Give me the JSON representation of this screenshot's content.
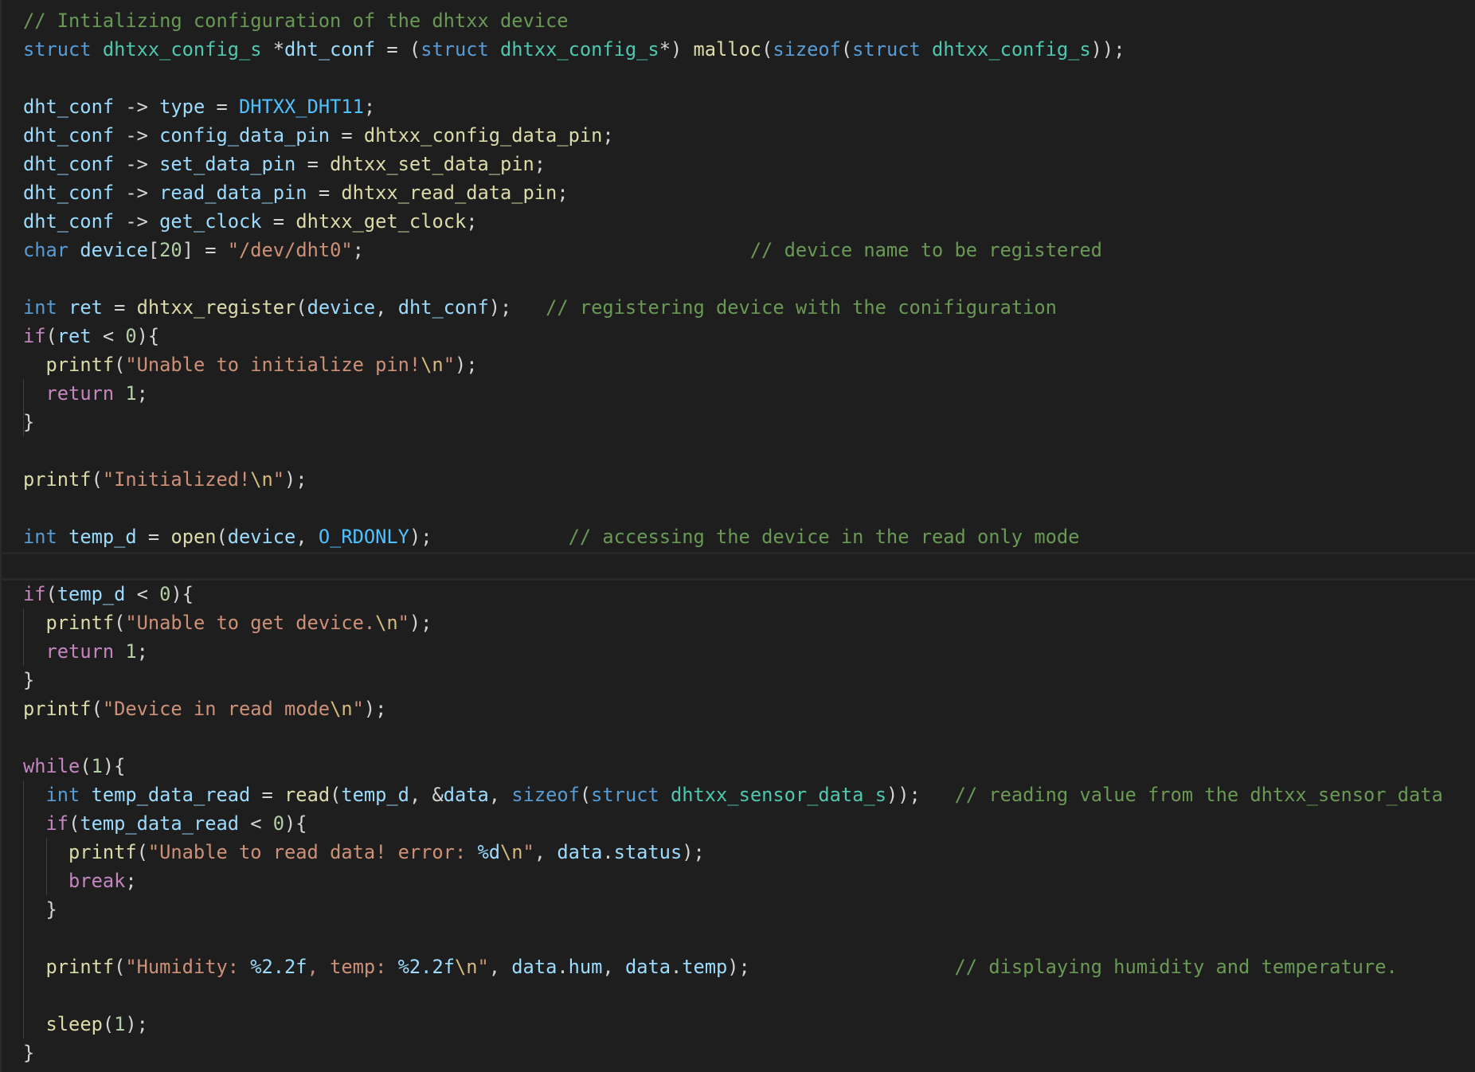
{
  "editor": {
    "colors": {
      "background": "#1e1e1e",
      "comment": "#6a9955",
      "keyword": "#569cd6",
      "control": "#c586c0",
      "type": "#4ec9b0",
      "variable": "#9cdcfe",
      "function": "#dcdcaa",
      "string": "#ce9178",
      "number": "#b5cea8",
      "constant": "#4fc1ff"
    },
    "lines": [
      [
        [
          "comment",
          "// Intializing configuration of the dhtxx device"
        ]
      ],
      [
        [
          "keyword",
          "struct"
        ],
        [
          "text",
          " "
        ],
        [
          "type",
          "dhtxx_config_s"
        ],
        [
          "text",
          " "
        ],
        [
          "operator",
          "*"
        ],
        [
          "variable",
          "dht_conf"
        ],
        [
          "text",
          " "
        ],
        [
          "operator",
          "="
        ],
        [
          "text",
          " "
        ],
        [
          "punct",
          "("
        ],
        [
          "keyword",
          "struct"
        ],
        [
          "text",
          " "
        ],
        [
          "type",
          "dhtxx_config_s"
        ],
        [
          "operator",
          "*"
        ],
        [
          "punct",
          ")"
        ],
        [
          "text",
          " "
        ],
        [
          "function",
          "malloc"
        ],
        [
          "punct",
          "("
        ],
        [
          "keyword",
          "sizeof"
        ],
        [
          "punct",
          "("
        ],
        [
          "keyword",
          "struct"
        ],
        [
          "text",
          " "
        ],
        [
          "type",
          "dhtxx_config_s"
        ],
        [
          "punct",
          "));"
        ]
      ],
      [],
      [
        [
          "variable",
          "dht_conf"
        ],
        [
          "text",
          " "
        ],
        [
          "operator",
          "->"
        ],
        [
          "text",
          " "
        ],
        [
          "variable",
          "type"
        ],
        [
          "text",
          " "
        ],
        [
          "operator",
          "="
        ],
        [
          "text",
          " "
        ],
        [
          "constant",
          "DHTXX_DHT11"
        ],
        [
          "punct",
          ";"
        ]
      ],
      [
        [
          "variable",
          "dht_conf"
        ],
        [
          "text",
          " "
        ],
        [
          "operator",
          "->"
        ],
        [
          "text",
          " "
        ],
        [
          "variable",
          "config_data_pin"
        ],
        [
          "text",
          " "
        ],
        [
          "operator",
          "="
        ],
        [
          "text",
          " "
        ],
        [
          "function",
          "dhtxx_config_data_pin"
        ],
        [
          "punct",
          ";"
        ]
      ],
      [
        [
          "variable",
          "dht_conf"
        ],
        [
          "text",
          " "
        ],
        [
          "operator",
          "->"
        ],
        [
          "text",
          " "
        ],
        [
          "variable",
          "set_data_pin"
        ],
        [
          "text",
          " "
        ],
        [
          "operator",
          "="
        ],
        [
          "text",
          " "
        ],
        [
          "function",
          "dhtxx_set_data_pin"
        ],
        [
          "punct",
          ";"
        ]
      ],
      [
        [
          "variable",
          "dht_conf"
        ],
        [
          "text",
          " "
        ],
        [
          "operator",
          "->"
        ],
        [
          "text",
          " "
        ],
        [
          "variable",
          "read_data_pin"
        ],
        [
          "text",
          " "
        ],
        [
          "operator",
          "="
        ],
        [
          "text",
          " "
        ],
        [
          "function",
          "dhtxx_read_data_pin"
        ],
        [
          "punct",
          ";"
        ]
      ],
      [
        [
          "variable",
          "dht_conf"
        ],
        [
          "text",
          " "
        ],
        [
          "operator",
          "->"
        ],
        [
          "text",
          " "
        ],
        [
          "variable",
          "get_clock"
        ],
        [
          "text",
          " "
        ],
        [
          "operator",
          "="
        ],
        [
          "text",
          " "
        ],
        [
          "function",
          "dhtxx_get_clock"
        ],
        [
          "punct",
          ";"
        ]
      ],
      [
        [
          "keyword",
          "char"
        ],
        [
          "text",
          " "
        ],
        [
          "variable",
          "device"
        ],
        [
          "punct",
          "["
        ],
        [
          "number",
          "20"
        ],
        [
          "punct",
          "]"
        ],
        [
          "text",
          " "
        ],
        [
          "operator",
          "="
        ],
        [
          "text",
          " "
        ],
        [
          "string",
          "\"/dev/dht0\""
        ],
        [
          "punct",
          ";"
        ],
        [
          "text",
          "                                  "
        ],
        [
          "comment",
          "// device name to be registered"
        ]
      ],
      [],
      [
        [
          "keyword",
          "int"
        ],
        [
          "text",
          " "
        ],
        [
          "variable",
          "ret"
        ],
        [
          "text",
          " "
        ],
        [
          "operator",
          "="
        ],
        [
          "text",
          " "
        ],
        [
          "function",
          "dhtxx_register"
        ],
        [
          "punct",
          "("
        ],
        [
          "variable",
          "device"
        ],
        [
          "punct",
          ","
        ],
        [
          "text",
          " "
        ],
        [
          "variable",
          "dht_conf"
        ],
        [
          "punct",
          ");"
        ],
        [
          "text",
          "   "
        ],
        [
          "comment",
          "// registering device with the conifiguration"
        ]
      ],
      [
        [
          "control",
          "if"
        ],
        [
          "punct",
          "("
        ],
        [
          "variable",
          "ret"
        ],
        [
          "text",
          " "
        ],
        [
          "operator",
          "<"
        ],
        [
          "text",
          " "
        ],
        [
          "number",
          "0"
        ],
        [
          "punct",
          "){"
        ]
      ],
      [
        [
          "text",
          "  "
        ],
        [
          "function",
          "printf"
        ],
        [
          "punct",
          "("
        ],
        [
          "string",
          "\"Unable to initialize pin!"
        ],
        [
          "escape",
          "\\n"
        ],
        [
          "string",
          "\""
        ],
        [
          "punct",
          ");"
        ]
      ],
      [
        [
          "text",
          "  "
        ],
        [
          "control",
          "return"
        ],
        [
          "text",
          " "
        ],
        [
          "number",
          "1"
        ],
        [
          "punct",
          ";"
        ]
      ],
      [
        [
          "punct",
          "}"
        ]
      ],
      [],
      [
        [
          "function",
          "printf"
        ],
        [
          "punct",
          "("
        ],
        [
          "string",
          "\"Initialized!"
        ],
        [
          "escape",
          "\\n"
        ],
        [
          "string",
          "\""
        ],
        [
          "punct",
          ");"
        ]
      ],
      [],
      [
        [
          "keyword",
          "int"
        ],
        [
          "text",
          " "
        ],
        [
          "variable",
          "temp_d"
        ],
        [
          "text",
          " "
        ],
        [
          "operator",
          "="
        ],
        [
          "text",
          " "
        ],
        [
          "function",
          "open"
        ],
        [
          "punct",
          "("
        ],
        [
          "variable",
          "device"
        ],
        [
          "punct",
          ","
        ],
        [
          "text",
          " "
        ],
        [
          "constant",
          "O_RDONLY"
        ],
        [
          "punct",
          ");"
        ],
        [
          "text",
          "            "
        ],
        [
          "comment",
          "// accessing the device in the read only mode"
        ]
      ],
      [],
      [
        [
          "control",
          "if"
        ],
        [
          "punct",
          "("
        ],
        [
          "variable",
          "temp_d"
        ],
        [
          "text",
          " "
        ],
        [
          "operator",
          "<"
        ],
        [
          "text",
          " "
        ],
        [
          "number",
          "0"
        ],
        [
          "punct",
          "){"
        ]
      ],
      [
        [
          "text",
          "  "
        ],
        [
          "function",
          "printf"
        ],
        [
          "punct",
          "("
        ],
        [
          "string",
          "\"Unable to get device."
        ],
        [
          "escape",
          "\\n"
        ],
        [
          "string",
          "\""
        ],
        [
          "punct",
          ");"
        ]
      ],
      [
        [
          "text",
          "  "
        ],
        [
          "control",
          "return"
        ],
        [
          "text",
          " "
        ],
        [
          "number",
          "1"
        ],
        [
          "punct",
          ";"
        ]
      ],
      [
        [
          "punct",
          "}"
        ]
      ],
      [
        [
          "function",
          "printf"
        ],
        [
          "punct",
          "("
        ],
        [
          "string",
          "\"Device in read mode"
        ],
        [
          "escape",
          "\\n"
        ],
        [
          "string",
          "\""
        ],
        [
          "punct",
          ");"
        ]
      ],
      [],
      [
        [
          "control",
          "while"
        ],
        [
          "punct",
          "("
        ],
        [
          "number",
          "1"
        ],
        [
          "punct",
          "){"
        ]
      ],
      [
        [
          "text",
          "  "
        ],
        [
          "keyword",
          "int"
        ],
        [
          "text",
          " "
        ],
        [
          "variable",
          "temp_data_read"
        ],
        [
          "text",
          " "
        ],
        [
          "operator",
          "="
        ],
        [
          "text",
          " "
        ],
        [
          "function",
          "read"
        ],
        [
          "punct",
          "("
        ],
        [
          "variable",
          "temp_d"
        ],
        [
          "punct",
          ","
        ],
        [
          "text",
          " "
        ],
        [
          "operator",
          "&"
        ],
        [
          "variable",
          "data"
        ],
        [
          "punct",
          ","
        ],
        [
          "text",
          " "
        ],
        [
          "keyword",
          "sizeof"
        ],
        [
          "punct",
          "("
        ],
        [
          "keyword",
          "struct"
        ],
        [
          "text",
          " "
        ],
        [
          "type",
          "dhtxx_sensor_data_s"
        ],
        [
          "punct",
          "));"
        ],
        [
          "text",
          "   "
        ],
        [
          "comment",
          "// reading value from the dhtxx_sensor_data"
        ]
      ],
      [
        [
          "text",
          "  "
        ],
        [
          "control",
          "if"
        ],
        [
          "punct",
          "("
        ],
        [
          "variable",
          "temp_data_read"
        ],
        [
          "text",
          " "
        ],
        [
          "operator",
          "<"
        ],
        [
          "text",
          " "
        ],
        [
          "number",
          "0"
        ],
        [
          "punct",
          "){"
        ]
      ],
      [
        [
          "text",
          "    "
        ],
        [
          "function",
          "printf"
        ],
        [
          "punct",
          "("
        ],
        [
          "string",
          "\"Unable to read data! error: "
        ],
        [
          "format",
          "%d"
        ],
        [
          "escape",
          "\\n"
        ],
        [
          "string",
          "\""
        ],
        [
          "punct",
          ","
        ],
        [
          "text",
          " "
        ],
        [
          "variable",
          "data"
        ],
        [
          "punct",
          "."
        ],
        [
          "variable",
          "status"
        ],
        [
          "punct",
          ");"
        ]
      ],
      [
        [
          "text",
          "    "
        ],
        [
          "control",
          "break"
        ],
        [
          "punct",
          ";"
        ]
      ],
      [
        [
          "text",
          "  "
        ],
        [
          "punct",
          "}"
        ]
      ],
      [],
      [
        [
          "text",
          "  "
        ],
        [
          "function",
          "printf"
        ],
        [
          "punct",
          "("
        ],
        [
          "string",
          "\"Humidity: "
        ],
        [
          "format",
          "%2.2f"
        ],
        [
          "string",
          ", temp: "
        ],
        [
          "format",
          "%2.2f"
        ],
        [
          "escape",
          "\\n"
        ],
        [
          "string",
          "\""
        ],
        [
          "punct",
          ","
        ],
        [
          "text",
          " "
        ],
        [
          "variable",
          "data"
        ],
        [
          "punct",
          "."
        ],
        [
          "variable",
          "hum"
        ],
        [
          "punct",
          ","
        ],
        [
          "text",
          " "
        ],
        [
          "variable",
          "data"
        ],
        [
          "punct",
          "."
        ],
        [
          "variable",
          "temp"
        ],
        [
          "punct",
          ");"
        ],
        [
          "text",
          "                  "
        ],
        [
          "comment",
          "// displaying humidity and temperature."
        ]
      ],
      [],
      [
        [
          "text",
          "  "
        ],
        [
          "function",
          "sleep"
        ],
        [
          "punct",
          "("
        ],
        [
          "number",
          "1"
        ],
        [
          "punct",
          ");"
        ]
      ],
      [
        [
          "punct",
          "}"
        ]
      ]
    ]
  }
}
